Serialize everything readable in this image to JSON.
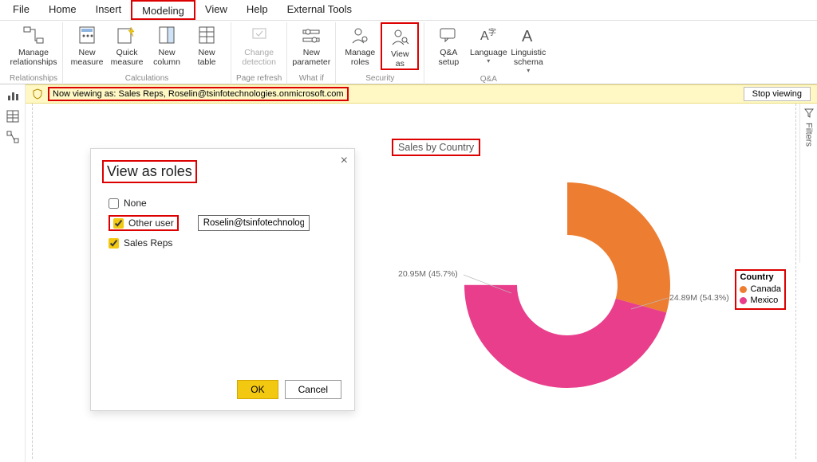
{
  "tabs": {
    "file": "File",
    "home": "Home",
    "insert": "Insert",
    "modeling": "Modeling",
    "view": "View",
    "help": "Help",
    "external": "External Tools"
  },
  "ribbon": {
    "manage_rel": "Manage\nrelationships",
    "rel_group": "Relationships",
    "new_measure": "New\nmeasure",
    "quick_measure": "Quick\nmeasure",
    "new_column": "New\ncolumn",
    "new_table": "New\ntable",
    "calc_group": "Calculations",
    "change_detect": "Change\ndetection",
    "refresh_group": "Page refresh",
    "new_param": "New\nparameter",
    "whatif_group": "What if",
    "manage_roles": "Manage\nroles",
    "view_as": "View\nas",
    "security_group": "Security",
    "qa_setup": "Q&A\nsetup",
    "language": "Language",
    "ling_schema": "Linguistic\nschema",
    "qa_group": "Q&A"
  },
  "notif": {
    "text": "Now viewing as: Sales Reps, Roselin@tsinfotechnologies.onmicrosoft.com",
    "stop": "Stop viewing"
  },
  "dialog": {
    "title": "View as roles",
    "none": "None",
    "other": "Other user",
    "salesreps": "Sales Reps",
    "user_value": "Roselin@tsinfotechnologies.",
    "ok": "OK",
    "cancel": "Cancel"
  },
  "chart_data": {
    "type": "pie",
    "title": "Sales by Country",
    "legend_title": "Country",
    "series": [
      {
        "name": "Canada",
        "value": 24.89,
        "pct": 54.3,
        "color": "#ed7d31",
        "label": "24.89M (54.3%)"
      },
      {
        "name": "Mexico",
        "value": 20.95,
        "pct": 45.7,
        "color": "#e83e8c",
        "label": "20.95M (45.7%)"
      }
    ]
  },
  "filters_label": "Filters"
}
